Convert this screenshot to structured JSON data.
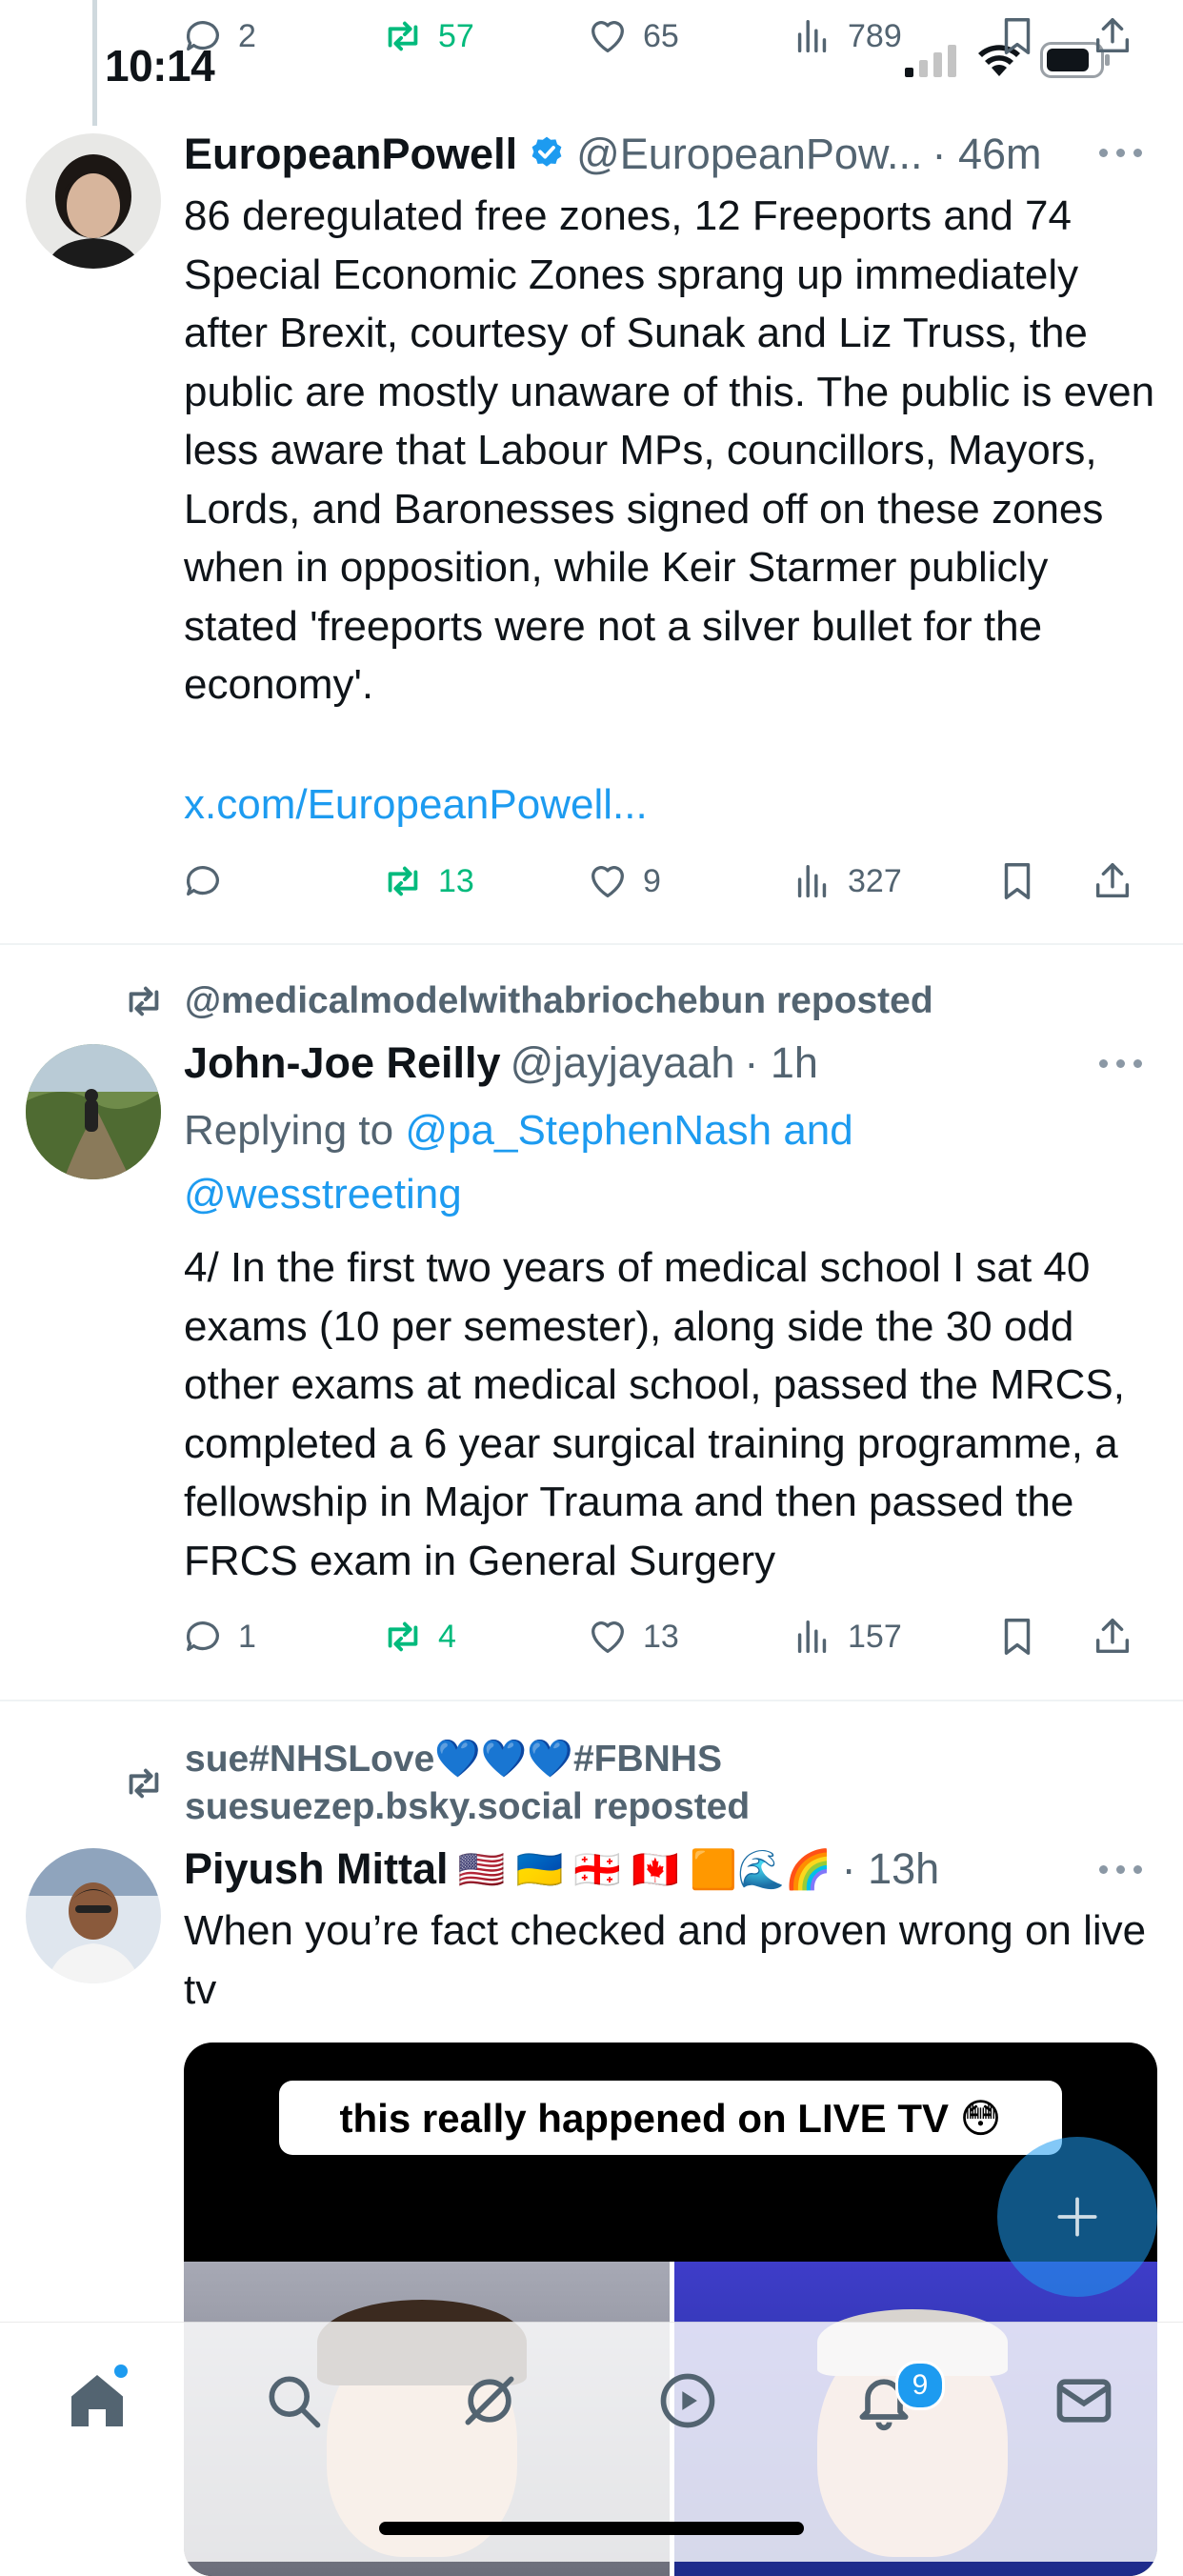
{
  "status_bar": {
    "time": "10:14"
  },
  "top_actions": {
    "replies": "2",
    "reposts": "57",
    "likes": "65",
    "views": "789"
  },
  "tweets": [
    {
      "name": "EuropeanPowell",
      "handle": "@EuropeanPow...",
      "time": "· 46m",
      "verified": true,
      "text": "86 deregulated free zones, 12 Freeports and 74 Special Economic Zones sprang up immediately after Brexit, courtesy of Sunak and Liz Truss, the public are mostly unaware of this.  The public is even less aware that Labour MPs, councillors, Mayors, Lords, and Baronesses signed off on these zones when in opposition, while Keir Starmer publicly stated 'freeports were not a silver bullet for the economy'.",
      "link": "x.com/EuropeanPowell...",
      "replies": "",
      "reposts": "13",
      "likes": "9",
      "views": "327"
    },
    {
      "repost_by": "@medicalmodelwithabriochebun reposted",
      "name": "John-Joe Reilly",
      "handle": "@jayjayaah",
      "time": "· 1h",
      "replying_label": "Replying to",
      "replying_to": "@pa_StephenNash and",
      "replying_to_2": "@wesstreeting",
      "text": "4/ In the first two years of medical school I sat 40 exams (10 per semester), along side the 30 odd other exams at medical school, passed the MRCS, completed a 6 year surgical training programme, a fellowship in Major Trauma and then passed the FRCS exam in General Surgery",
      "replies": "1",
      "reposts": "4",
      "likes": "13",
      "views": "157"
    },
    {
      "repost_by_line1": "sue#NHSLove💙💙💙#FBNHS",
      "repost_by_line2": "suesuezep.bsky.social reposted",
      "name": "Piyush Mittal",
      "flags": "🇺🇸 🇺🇦 🇬🇪 🇨🇦 🟧🌊🌈",
      "time": "· 13h",
      "text": "When you’re fact checked and proven wrong on live tv",
      "media_caption": "this really happened on LIVE TV 😳"
    }
  ],
  "tab_bar": {
    "notifications_badge": "9"
  },
  "colors": {
    "accent": "#1d9bf0",
    "repost_green": "#00ba7c",
    "muted": "#536471"
  }
}
